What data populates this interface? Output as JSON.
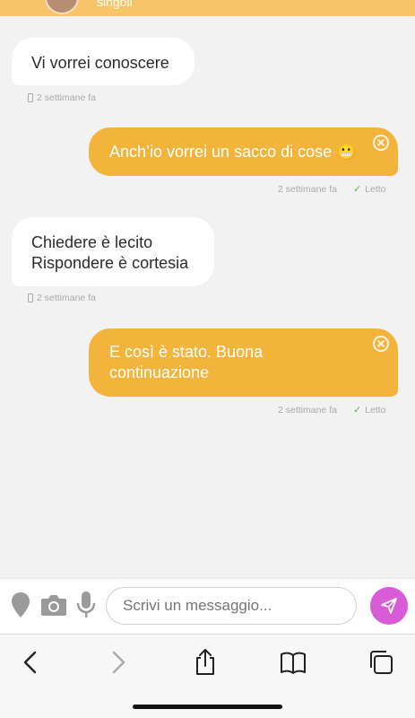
{
  "header": {
    "subtitle": "singoli"
  },
  "messages": [
    {
      "id": "m1",
      "direction": "incoming",
      "text": "Vi vorrei conoscere",
      "time": "2 settimane fa"
    },
    {
      "id": "m2",
      "direction": "outgoing",
      "text": "Anch’io vorrei un sacco di cose 😬",
      "time": "2 settimane fa",
      "status": "Letto"
    },
    {
      "id": "m3",
      "direction": "incoming",
      "text": "Chiedere è lecito\nRispondere è cortesia",
      "time": "2 settimane fa"
    },
    {
      "id": "m4",
      "direction": "outgoing",
      "text": "E così è stato. Buona\ncontinuazione",
      "time": "2 settimane fa",
      "status": "Letto"
    }
  ],
  "composer": {
    "placeholder": "Scrivi un messaggio...",
    "icons": [
      "location-pin-icon",
      "camera-icon",
      "microphone-icon",
      "send-icon"
    ]
  },
  "browser_toolbar": {
    "icons": [
      "back-icon",
      "forward-icon",
      "share-icon",
      "bookmarks-icon",
      "tabs-icon"
    ]
  },
  "colors": {
    "accent_outgoing": "#f3b43c",
    "header": "#f7c46a",
    "send_button": "#d85bd8",
    "read_check": "#66b04a",
    "background": "#f2f2f2"
  }
}
